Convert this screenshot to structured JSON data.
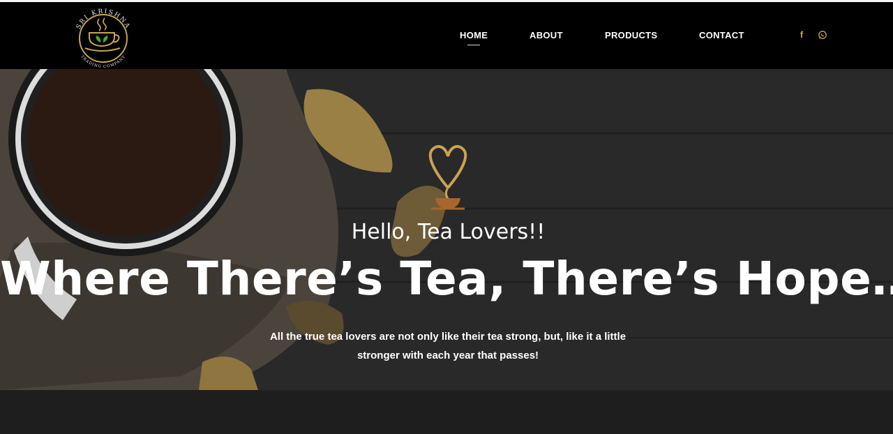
{
  "brand": {
    "name": "Sri Krishna Trading Company",
    "logo_top_text": "SRI KRISHNA",
    "logo_bottom_text": "TRADING COMPANY",
    "accent_color": "#c8a453"
  },
  "nav": {
    "items": [
      {
        "label": "HOME",
        "active": true
      },
      {
        "label": "ABOUT",
        "active": false
      },
      {
        "label": "PRODUCTS",
        "active": false
      },
      {
        "label": "CONTACT",
        "active": false
      }
    ],
    "social": [
      {
        "icon": "facebook-icon",
        "glyph": "f"
      },
      {
        "icon": "whatsapp-icon",
        "glyph": "✆"
      }
    ]
  },
  "hero": {
    "greeting": "Hello, Tea Lovers!!",
    "headline": "Where There’s Tea, There’s Hope…",
    "description": "All the true tea lovers are not only like their tea strong, but, like it a little stronger with each year that passes!",
    "icon": "heart-steam-tea-cup-icon"
  }
}
